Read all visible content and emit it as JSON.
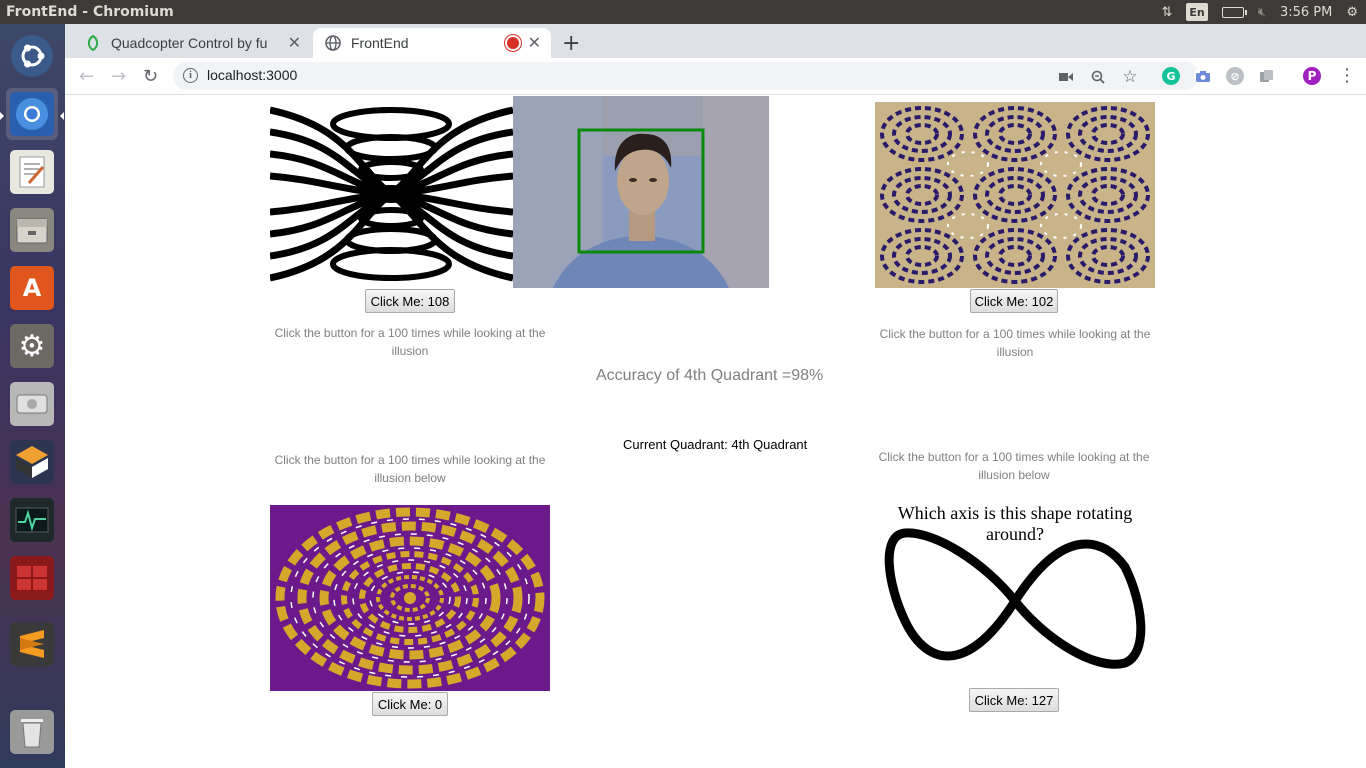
{
  "os_bar": {
    "window_title": "FrontEnd - Chromium",
    "language": "En",
    "time": "3:56 PM"
  },
  "launcher": {
    "items": [
      "ubuntu-home",
      "chromium",
      "text-editor",
      "file-manager",
      "software-center",
      "system-settings",
      "disk",
      "virtualbox",
      "system-monitor",
      "workspace-switcher",
      "sublime-text",
      "trash"
    ]
  },
  "browser": {
    "tabs": [
      {
        "title": "Quadcopter Control by fu",
        "active": false
      },
      {
        "title": "FrontEnd",
        "active": true
      }
    ],
    "url": "localhost:3000",
    "profile_initial": "P"
  },
  "page": {
    "button_top_left": "Click Me: 108",
    "button_top_right": "Click Me: 102",
    "button_bottom_left": "Click Me: 0",
    "button_bottom_right": "Click Me: 127",
    "hint_top_left": "Click the button for a 100 times while looking at the illusion",
    "hint_top_right": "Click the button for a 100 times while looking at the illusion",
    "hint_bottom_left": "Click the button for a 100 times while looking at the illusion below",
    "hint_bottom_right": "Click the button for a 100 times while looking at the illusion below",
    "accuracy": "Accuracy of 4th Quadrant =98%",
    "current_quadrant": "Current Quadrant: 4th Quadrant",
    "rotation_question": "Which axis is this shape rotating around?"
  },
  "colors": {
    "ubuntu_bar": "#3c3b37",
    "tab_strip": "#dee1e6",
    "face_box": "#0a8a0a",
    "illusion_purple": "#6a1a8a",
    "illusion_gold": "#d4a82a",
    "illusion_navy": "#2a1a6a",
    "illusion_tan": "#c8b488",
    "hint_text": "#808080"
  }
}
